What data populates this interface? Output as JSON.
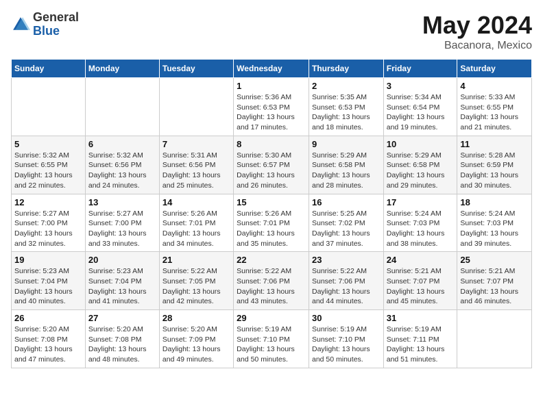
{
  "header": {
    "logo_general": "General",
    "logo_blue": "Blue",
    "title": "May 2024",
    "location": "Bacanora, Mexico"
  },
  "weekdays": [
    "Sunday",
    "Monday",
    "Tuesday",
    "Wednesday",
    "Thursday",
    "Friday",
    "Saturday"
  ],
  "weeks": [
    [
      {
        "day": "",
        "sunrise": "",
        "sunset": "",
        "daylight": ""
      },
      {
        "day": "",
        "sunrise": "",
        "sunset": "",
        "daylight": ""
      },
      {
        "day": "",
        "sunrise": "",
        "sunset": "",
        "daylight": ""
      },
      {
        "day": "1",
        "sunrise": "Sunrise: 5:36 AM",
        "sunset": "Sunset: 6:53 PM",
        "daylight": "Daylight: 13 hours and 17 minutes."
      },
      {
        "day": "2",
        "sunrise": "Sunrise: 5:35 AM",
        "sunset": "Sunset: 6:53 PM",
        "daylight": "Daylight: 13 hours and 18 minutes."
      },
      {
        "day": "3",
        "sunrise": "Sunrise: 5:34 AM",
        "sunset": "Sunset: 6:54 PM",
        "daylight": "Daylight: 13 hours and 19 minutes."
      },
      {
        "day": "4",
        "sunrise": "Sunrise: 5:33 AM",
        "sunset": "Sunset: 6:55 PM",
        "daylight": "Daylight: 13 hours and 21 minutes."
      }
    ],
    [
      {
        "day": "5",
        "sunrise": "Sunrise: 5:32 AM",
        "sunset": "Sunset: 6:55 PM",
        "daylight": "Daylight: 13 hours and 22 minutes."
      },
      {
        "day": "6",
        "sunrise": "Sunrise: 5:32 AM",
        "sunset": "Sunset: 6:56 PM",
        "daylight": "Daylight: 13 hours and 24 minutes."
      },
      {
        "day": "7",
        "sunrise": "Sunrise: 5:31 AM",
        "sunset": "Sunset: 6:56 PM",
        "daylight": "Daylight: 13 hours and 25 minutes."
      },
      {
        "day": "8",
        "sunrise": "Sunrise: 5:30 AM",
        "sunset": "Sunset: 6:57 PM",
        "daylight": "Daylight: 13 hours and 26 minutes."
      },
      {
        "day": "9",
        "sunrise": "Sunrise: 5:29 AM",
        "sunset": "Sunset: 6:58 PM",
        "daylight": "Daylight: 13 hours and 28 minutes."
      },
      {
        "day": "10",
        "sunrise": "Sunrise: 5:29 AM",
        "sunset": "Sunset: 6:58 PM",
        "daylight": "Daylight: 13 hours and 29 minutes."
      },
      {
        "day": "11",
        "sunrise": "Sunrise: 5:28 AM",
        "sunset": "Sunset: 6:59 PM",
        "daylight": "Daylight: 13 hours and 30 minutes."
      }
    ],
    [
      {
        "day": "12",
        "sunrise": "Sunrise: 5:27 AM",
        "sunset": "Sunset: 7:00 PM",
        "daylight": "Daylight: 13 hours and 32 minutes."
      },
      {
        "day": "13",
        "sunrise": "Sunrise: 5:27 AM",
        "sunset": "Sunset: 7:00 PM",
        "daylight": "Daylight: 13 hours and 33 minutes."
      },
      {
        "day": "14",
        "sunrise": "Sunrise: 5:26 AM",
        "sunset": "Sunset: 7:01 PM",
        "daylight": "Daylight: 13 hours and 34 minutes."
      },
      {
        "day": "15",
        "sunrise": "Sunrise: 5:26 AM",
        "sunset": "Sunset: 7:01 PM",
        "daylight": "Daylight: 13 hours and 35 minutes."
      },
      {
        "day": "16",
        "sunrise": "Sunrise: 5:25 AM",
        "sunset": "Sunset: 7:02 PM",
        "daylight": "Daylight: 13 hours and 37 minutes."
      },
      {
        "day": "17",
        "sunrise": "Sunrise: 5:24 AM",
        "sunset": "Sunset: 7:03 PM",
        "daylight": "Daylight: 13 hours and 38 minutes."
      },
      {
        "day": "18",
        "sunrise": "Sunrise: 5:24 AM",
        "sunset": "Sunset: 7:03 PM",
        "daylight": "Daylight: 13 hours and 39 minutes."
      }
    ],
    [
      {
        "day": "19",
        "sunrise": "Sunrise: 5:23 AM",
        "sunset": "Sunset: 7:04 PM",
        "daylight": "Daylight: 13 hours and 40 minutes."
      },
      {
        "day": "20",
        "sunrise": "Sunrise: 5:23 AM",
        "sunset": "Sunset: 7:04 PM",
        "daylight": "Daylight: 13 hours and 41 minutes."
      },
      {
        "day": "21",
        "sunrise": "Sunrise: 5:22 AM",
        "sunset": "Sunset: 7:05 PM",
        "daylight": "Daylight: 13 hours and 42 minutes."
      },
      {
        "day": "22",
        "sunrise": "Sunrise: 5:22 AM",
        "sunset": "Sunset: 7:06 PM",
        "daylight": "Daylight: 13 hours and 43 minutes."
      },
      {
        "day": "23",
        "sunrise": "Sunrise: 5:22 AM",
        "sunset": "Sunset: 7:06 PM",
        "daylight": "Daylight: 13 hours and 44 minutes."
      },
      {
        "day": "24",
        "sunrise": "Sunrise: 5:21 AM",
        "sunset": "Sunset: 7:07 PM",
        "daylight": "Daylight: 13 hours and 45 minutes."
      },
      {
        "day": "25",
        "sunrise": "Sunrise: 5:21 AM",
        "sunset": "Sunset: 7:07 PM",
        "daylight": "Daylight: 13 hours and 46 minutes."
      }
    ],
    [
      {
        "day": "26",
        "sunrise": "Sunrise: 5:20 AM",
        "sunset": "Sunset: 7:08 PM",
        "daylight": "Daylight: 13 hours and 47 minutes."
      },
      {
        "day": "27",
        "sunrise": "Sunrise: 5:20 AM",
        "sunset": "Sunset: 7:08 PM",
        "daylight": "Daylight: 13 hours and 48 minutes."
      },
      {
        "day": "28",
        "sunrise": "Sunrise: 5:20 AM",
        "sunset": "Sunset: 7:09 PM",
        "daylight": "Daylight: 13 hours and 49 minutes."
      },
      {
        "day": "29",
        "sunrise": "Sunrise: 5:19 AM",
        "sunset": "Sunset: 7:10 PM",
        "daylight": "Daylight: 13 hours and 50 minutes."
      },
      {
        "day": "30",
        "sunrise": "Sunrise: 5:19 AM",
        "sunset": "Sunset: 7:10 PM",
        "daylight": "Daylight: 13 hours and 50 minutes."
      },
      {
        "day": "31",
        "sunrise": "Sunrise: 5:19 AM",
        "sunset": "Sunset: 7:11 PM",
        "daylight": "Daylight: 13 hours and 51 minutes."
      },
      {
        "day": "",
        "sunrise": "",
        "sunset": "",
        "daylight": ""
      }
    ]
  ]
}
